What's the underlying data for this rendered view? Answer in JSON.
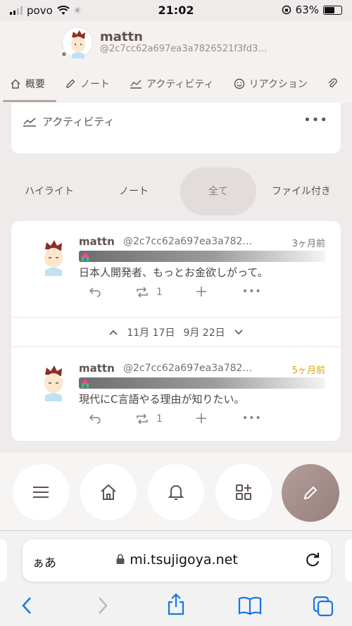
{
  "status": {
    "carrier": "povo",
    "time": "21:02",
    "battery": "63%"
  },
  "profile": {
    "name": "mattn",
    "id": "@2c7cc62a697ea3a7826521f3fd3…"
  },
  "tabs": [
    {
      "label": "概要",
      "icon": "home-icon"
    },
    {
      "label": "ノート",
      "icon": "pencil-icon"
    },
    {
      "label": "アクティビティ",
      "icon": "chart-icon"
    },
    {
      "label": "リアクション",
      "icon": "smile-icon"
    }
  ],
  "activity": {
    "title": "アクティビティ"
  },
  "filters": [
    {
      "label": "ハイライト"
    },
    {
      "label": "ノート"
    },
    {
      "label": "全て"
    },
    {
      "label": "ファイル付き"
    }
  ],
  "notes": [
    {
      "name": "mattn",
      "acct": "@2c7cc62a697ea3a782…",
      "time": "3ヶ月前",
      "text": "日本人開発者、もっとお金欲しがって。",
      "renote_count": "1"
    },
    {
      "name": "mattn",
      "acct": "@2c7cc62a697ea3a782…",
      "time": "5ヶ月前",
      "text": "現代にC言語やる理由が知りたい。",
      "renote_count": "1"
    }
  ],
  "datebar": {
    "prev": "11月 17日",
    "next": "9月 22日"
  },
  "safari": {
    "aa": "ぁあ",
    "url": "mi.tsujigoya.net"
  }
}
